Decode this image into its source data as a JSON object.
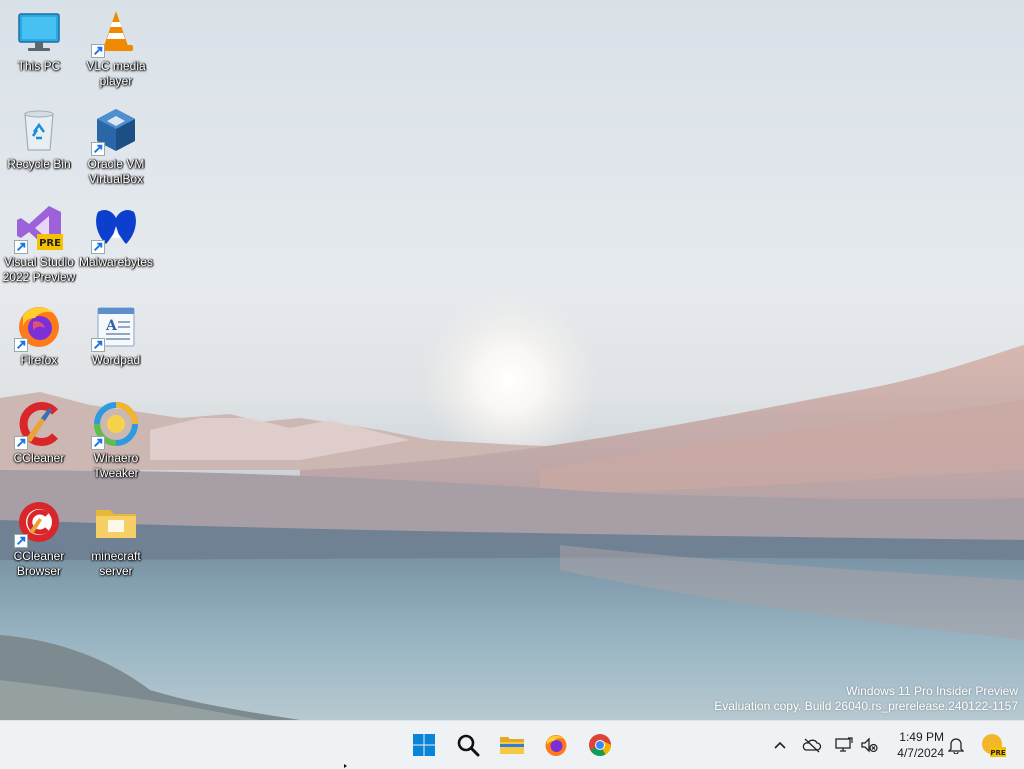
{
  "desktop": {
    "icons": [
      {
        "label": "This PC",
        "icon": "monitor-icon"
      },
      {
        "label": "VLC media player",
        "icon": "vlc-cone-icon"
      },
      {
        "label": "Recycle Bin",
        "icon": "recycle-bin-icon"
      },
      {
        "label": "Oracle VM VirtualBox",
        "icon": "virtualbox-icon"
      },
      {
        "label": "Visual Studio 2022 Preview",
        "icon": "visual-studio-icon",
        "badge": "PRE"
      },
      {
        "label": "Malwarebytes",
        "icon": "malwarebytes-icon"
      },
      {
        "label": "Firefox",
        "icon": "firefox-icon"
      },
      {
        "label": "Wordpad",
        "icon": "wordpad-icon"
      },
      {
        "label": "CCleaner",
        "icon": "ccleaner-icon"
      },
      {
        "label": "Winaero Tweaker",
        "icon": "winaero-tweaker-icon"
      },
      {
        "label": "CCleaner Browser",
        "icon": "ccleaner-browser-icon"
      },
      {
        "label": "minecraft server",
        "icon": "folder-icon"
      }
    ]
  },
  "watermark": {
    "line1": "Windows 11 Pro Insider Preview",
    "line2": "Evaluation copy. Build 26040.rs_prerelease.240122-1157"
  },
  "taskbar": {
    "pinned": [
      "start-icon",
      "search-icon",
      "file-explorer-icon",
      "firefox-icon",
      "chrome-icon"
    ],
    "tray": [
      "chevron-up-icon",
      "onedrive-icon",
      "network-icon",
      "volume-muted-icon",
      "notifications-bell-icon",
      "dev-build-icon"
    ],
    "time": "1:49 PM",
    "date": "4/7/2024",
    "tray_badge": "PRE"
  },
  "colors": {
    "taskbar_bg": "#eff2f4",
    "start_blue": "#0a84d8",
    "folder_yellow": "#f2c94c"
  }
}
